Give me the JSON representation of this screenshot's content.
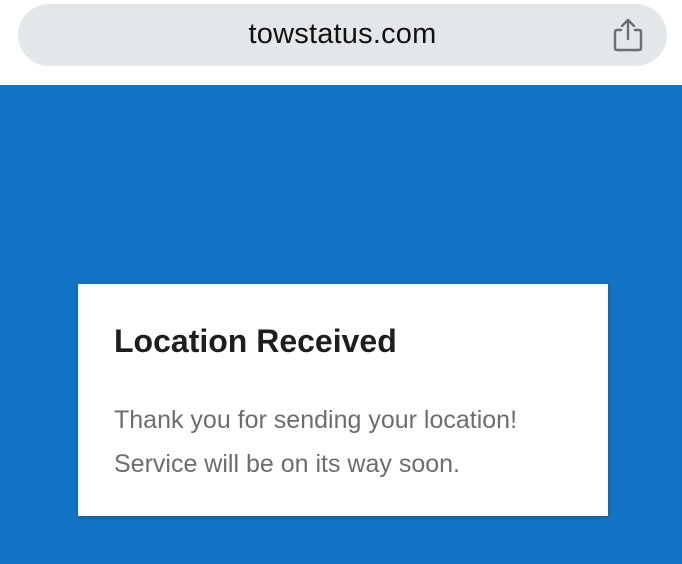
{
  "browser": {
    "url": "towstatus.com",
    "share_icon": "share-icon"
  },
  "page": {
    "background_color": "#1373c4",
    "card": {
      "title": "Location Received",
      "message_line1": "Thank you for sending your location!",
      "message_line2": "Service will be on its way soon."
    }
  }
}
